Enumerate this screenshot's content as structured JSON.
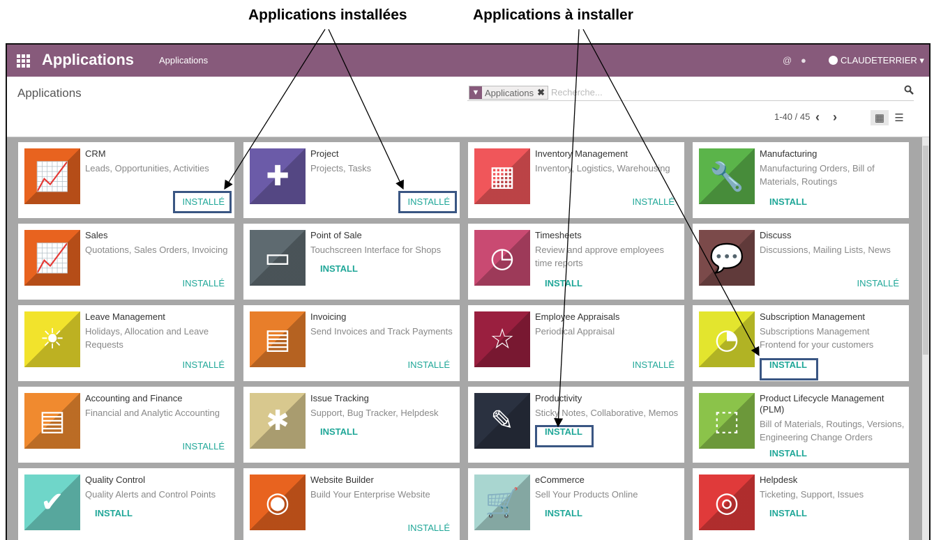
{
  "annotations": {
    "installed": "Applications installées",
    "to_install": "Applications à installer"
  },
  "topbar": {
    "brand": "Applications",
    "menu": "Applications",
    "at_icon": "@",
    "chat_icon": "chat-icon",
    "user": "CLAUDETERRIER",
    "bg": "#875a7b"
  },
  "control_panel": {
    "title": "Applications",
    "facet_label": "Applications",
    "search_placeholder": "Recherche...",
    "pager": "1-40 / 45"
  },
  "status_labels": {
    "installed": "INSTALLÉ",
    "install": "INSTALL"
  },
  "apps": [
    {
      "name": "CRM",
      "desc": "Leads, Opportunities, Activities",
      "status": "INSTALLÉ",
      "installed": true,
      "color": "#e8631f",
      "icon": "chart-icon"
    },
    {
      "name": "Project",
      "desc": "Projects, Tasks",
      "status": "INSTALLÉ",
      "installed": true,
      "color": "#6b5ba8",
      "icon": "puzzle-icon"
    },
    {
      "name": "Inventory Management",
      "desc": "Inventory, Logistics, Warehousing",
      "status": "INSTALLÉ",
      "installed": true,
      "color": "#f0565a",
      "icon": "warehouse-icon"
    },
    {
      "name": "Manufacturing",
      "desc": "Manufacturing Orders, Bill of Materials, Routings",
      "status": "INSTALL",
      "installed": false,
      "color": "#5bb44a",
      "icon": "wrench-icon"
    },
    {
      "name": "Sales",
      "desc": "Quotations, Sales Orders, Invoicing",
      "status": "INSTALLÉ",
      "installed": true,
      "color": "#e8631f",
      "icon": "chart-icon"
    },
    {
      "name": "Point of Sale",
      "desc": "Touchscreen Interface for Shops",
      "status": "INSTALL",
      "installed": false,
      "color": "#5e6a70",
      "icon": "monitor-icon"
    },
    {
      "name": "Timesheets",
      "desc": "Review and approve employees time reports",
      "status": "INSTALL",
      "installed": false,
      "color": "#c94a72",
      "icon": "clock-icon"
    },
    {
      "name": "Discuss",
      "desc": "Discussions, Mailing Lists, News",
      "status": "INSTALLÉ",
      "installed": true,
      "color": "#7b4a4a",
      "icon": "speech-bubble-icon"
    },
    {
      "name": "Leave Management",
      "desc": "Holidays, Allocation and Leave Requests",
      "status": "INSTALLÉ",
      "installed": true,
      "color": "#f2e32c",
      "icon": "sun-icon"
    },
    {
      "name": "Invoicing",
      "desc": "Send Invoices and Track Payments",
      "status": "INSTALLÉ",
      "installed": true,
      "color": "#e87e2a",
      "icon": "document-icon"
    },
    {
      "name": "Employee Appraisals",
      "desc": "Periodical Appraisal",
      "status": "INSTALLÉ",
      "installed": true,
      "color": "#9a1f3f",
      "icon": "star-icon"
    },
    {
      "name": "Subscription Management",
      "desc": "Subscriptions Management Frontend for your customers",
      "status": "INSTALL",
      "installed": false,
      "color": "#e3e52e",
      "icon": "rss-icon"
    },
    {
      "name": "Accounting and Finance",
      "desc": "Financial and Analytic Accounting",
      "status": "INSTALLÉ",
      "installed": true,
      "color": "#f08a2f",
      "icon": "document-icon"
    },
    {
      "name": "Issue Tracking",
      "desc": "Support, Bug Tracker, Helpdesk",
      "status": "INSTALL",
      "installed": false,
      "color": "#d8c88e",
      "icon": "bug-icon"
    },
    {
      "name": "Productivity",
      "desc": "Sticky Notes, Collaborative, Memos",
      "status": "INSTALL",
      "installed": false,
      "color": "#2a3140",
      "icon": "note-pencil-icon"
    },
    {
      "name": "Product Lifecycle Management (PLM)",
      "desc": "Bill of Materials, Routings, Versions, Engineering Change Orders",
      "status": "INSTALL",
      "installed": false,
      "color": "#8bc34a",
      "icon": "box-icon"
    },
    {
      "name": "Quality Control",
      "desc": "Quality Alerts and Control Points",
      "status": "INSTALL",
      "installed": false,
      "color": "#6fd6c9",
      "icon": "clipboard-check-icon"
    },
    {
      "name": "Website Builder",
      "desc": "Build Your Enterprise Website",
      "status": "INSTALLÉ",
      "installed": true,
      "color": "#e8631f",
      "icon": "globe-icon"
    },
    {
      "name": "eCommerce",
      "desc": "Sell Your Products Online",
      "status": "INSTALL",
      "installed": false,
      "color": "#a9d6d0",
      "icon": "cart-icon"
    },
    {
      "name": "Helpdesk",
      "desc": "Ticketing, Support, Issues",
      "status": "INSTALL",
      "installed": false,
      "color": "#e03a3a",
      "icon": "lifebuoy-icon"
    }
  ]
}
